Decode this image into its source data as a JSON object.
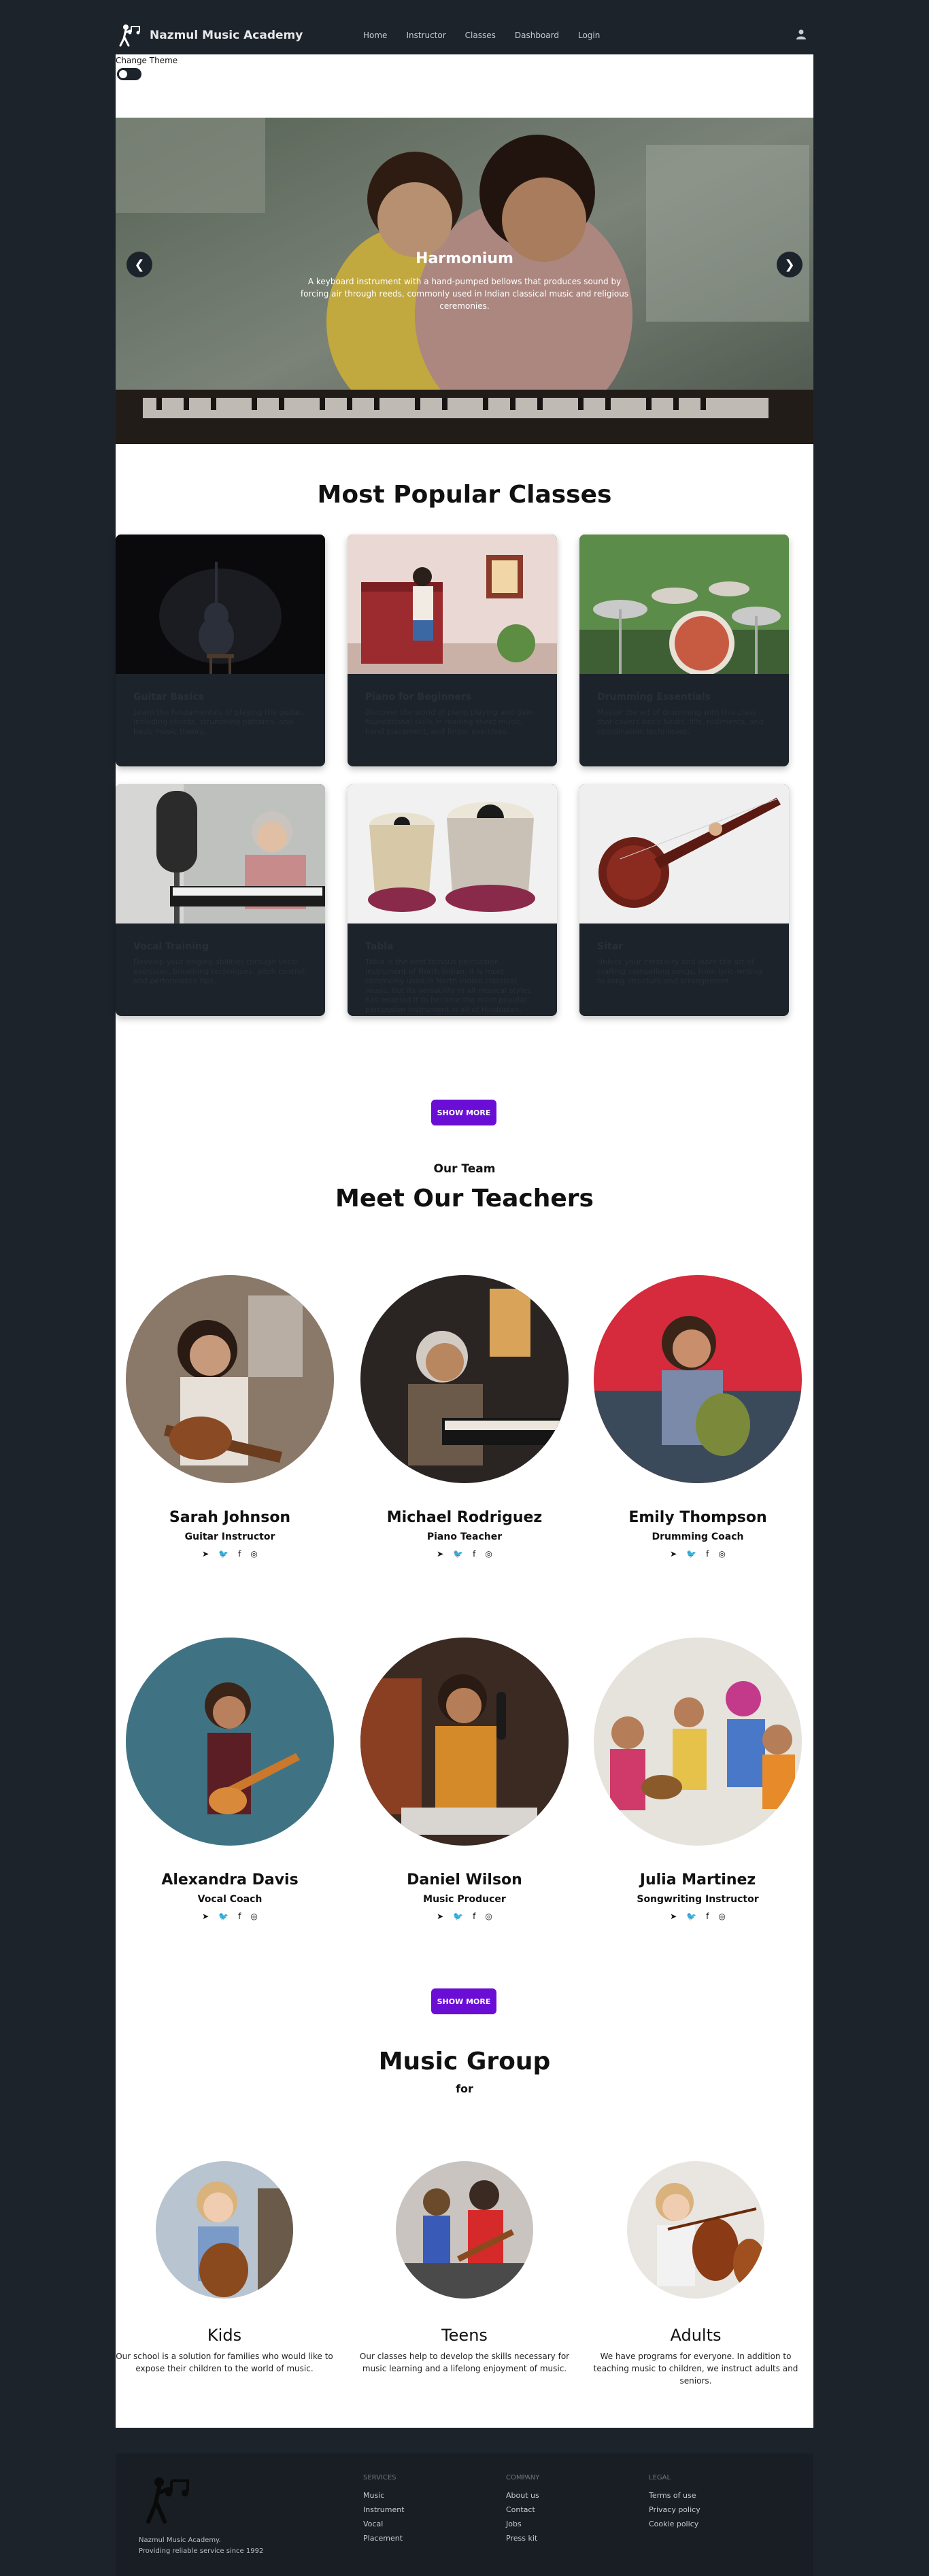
{
  "nav": {
    "brand": "Nazmul Music Academy",
    "links": [
      "Home",
      "Instructor",
      "Classes",
      "Dashboard",
      "Login"
    ],
    "user_icon": "user-icon"
  },
  "theme": {
    "label": "Change Theme"
  },
  "carousel": {
    "title": "Harmonium",
    "description": "A keyboard instrument with a hand-pumped bellows that produces sound by forcing air through reeds, commonly used in Indian classical music and religious ceremonies.",
    "prev": "❮",
    "next": "❯"
  },
  "classes": {
    "heading": "Most Popular Classes",
    "items": [
      {
        "title": "Guitar Basics",
        "text": "Learn the fundamentals of playing the guitar, including chords, strumming patterns, and basic music theory."
      },
      {
        "title": "Piano for Beginners",
        "text": "Discover the world of piano playing and gain foundational skills in reading sheet music, hand placement, and finger exercises."
      },
      {
        "title": "Drumming Essentials",
        "text": "Master the art of drumming with this class that covers basic beats, fills, rudiments, and coordination techniques."
      },
      {
        "title": "Vocal Training",
        "text": "Develop your singing abilities through vocal exercises, breathing techniques, pitch control, and performance tips."
      },
      {
        "title": "Tabla",
        "text": "Tabla is the best famous percussion instrument of North Indian. It is most commonly used in North Indian classical music, but its versatility in all musical styles has enabled it to become the most popular percussion instrument in all of Hindustan."
      },
      {
        "title": "Sitar",
        "text": "Unlock your creativity and learn the art of crafting compelling songs, from lyric-writing to song structure and arrangement."
      }
    ],
    "button": "SHOW MORE"
  },
  "team": {
    "kicker": "Our Team",
    "heading": "Meet Our Teachers",
    "teachers": [
      {
        "name": "Sarah Johnson",
        "role": "Guitar Instructor"
      },
      {
        "name": "Michael Rodriguez",
        "role": "Piano Teacher"
      },
      {
        "name": "Emily Thompson",
        "role": "Drumming Coach"
      },
      {
        "name": "Alexandra Davis",
        "role": "Vocal Coach"
      },
      {
        "name": "Daniel Wilson",
        "role": "Music Producer"
      },
      {
        "name": "Julia Martinez",
        "role": "Songwriting Instructor"
      }
    ],
    "social_icons": [
      "➤",
      "🐦",
      "f",
      "◎"
    ],
    "button": "SHOW MORE"
  },
  "groups": {
    "heading": "Music Group",
    "sub": "for",
    "items": [
      {
        "title": "Kids",
        "text": "Our school is a solution for families who would like to expose their children to the world of music."
      },
      {
        "title": "Teens",
        "text": "Our classes help to develop the skills necessary for music learning and a lifelong enjoyment of music."
      },
      {
        "title": "Adults",
        "text": "We have programs for everyone. In addition to teaching music to children, we instruct adults and seniors."
      }
    ]
  },
  "footer": {
    "info_line1": "Nazmul Music Academy.",
    "info_line2": "Providing reliable service since 1992",
    "services": {
      "heading": "SERVICES",
      "items": [
        "Music",
        "Instrument",
        "Vocal",
        "Placement"
      ]
    },
    "company": {
      "heading": "COMPANY",
      "items": [
        "About us",
        "Contact",
        "Jobs",
        "Press kit"
      ]
    },
    "legal": {
      "heading": "LEGAL",
      "items": [
        "Terms of use",
        "Privacy policy",
        "Cookie policy"
      ]
    }
  }
}
